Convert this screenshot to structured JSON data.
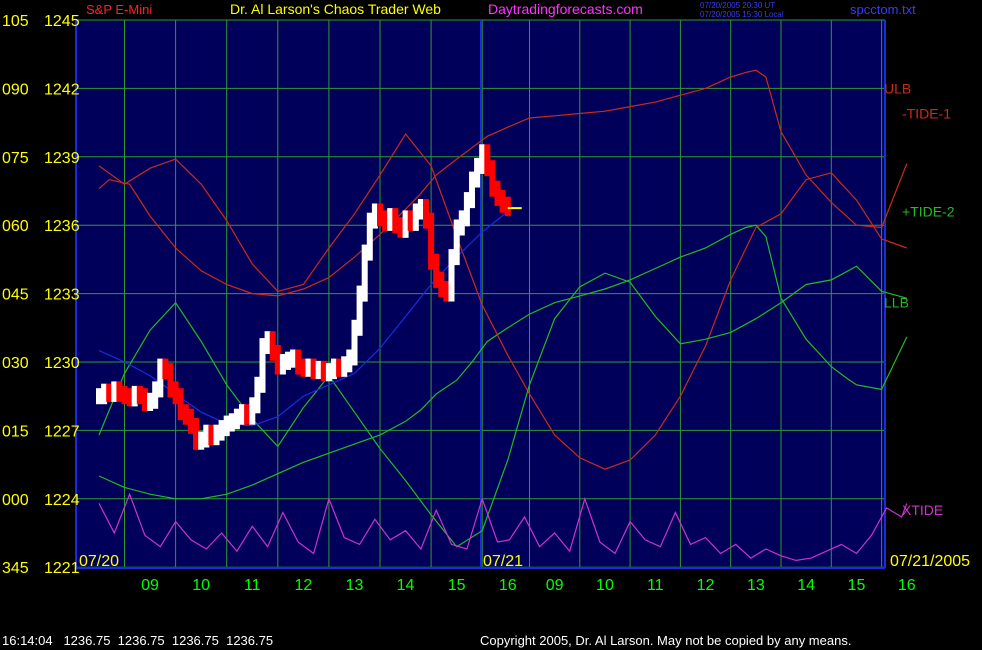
{
  "header": {
    "title_left": "S&P E-Mini",
    "title_main": "Dr. Al Larson's Chaos Trader Web",
    "site": "Daytradingforecasts.com",
    "stamp1": "07/20/2005 20:30 UT",
    "stamp2": "07/20/2005 15:30 Local",
    "file": "spcctom.txt"
  },
  "footer": {
    "quote": "16:14:04   1236.75  1236.75  1236.75  1236.75",
    "copyright": "Copyright 2005, Dr. Al Larson. May not be copied by any means."
  },
  "colors": {
    "background": "#00005a",
    "grid": "#2f9a2f",
    "price_up": "#ffffff",
    "price_down": "#ff0000",
    "ulb": "#cc2a1a",
    "llb": "#22bb22",
    "xtide": "#cc33cc",
    "average": "#1a2be0",
    "left_labels": "#ffff00",
    "time_labels": "#00ff00"
  },
  "chart_data": {
    "type": "line",
    "left_axis": {
      "labels": [
        {
          "code": "105",
          "price": "1245",
          "value": 1245
        },
        {
          "code": "090",
          "price": "1242",
          "value": 1242
        },
        {
          "code": "075",
          "price": "1239",
          "value": 1239
        },
        {
          "code": "060",
          "price": "1236",
          "value": 1236
        },
        {
          "code": "045",
          "price": "1233",
          "value": 1233
        },
        {
          "code": "030",
          "price": "1230",
          "value": 1230
        },
        {
          "code": "015",
          "price": "1227",
          "value": 1227
        },
        {
          "code": "000",
          "price": "1224",
          "value": 1224
        },
        {
          "code": "345",
          "price": "1221",
          "value": 1221
        }
      ],
      "ylim": [
        1221,
        1245
      ]
    },
    "time_axis": {
      "hours": [
        "09",
        "10",
        "11",
        "12",
        "13",
        "14",
        "15",
        "16",
        "09",
        "10",
        "11",
        "12",
        "13",
        "14",
        "15",
        "16"
      ],
      "date_start": "07/20",
      "date_mid": "07/21",
      "date_end": "07/21/2005"
    },
    "series": [
      {
        "name": "ULB",
        "color": "#cc2a1a",
        "x": [
          0,
          0.2,
          0.6,
          1.0,
          1.5,
          2.0,
          2.5,
          3.0,
          3.5,
          4.0,
          4.5,
          5.0,
          5.5,
          6.0,
          6.3,
          6.6,
          7.0,
          7.3,
          7.6,
          8.0,
          8.5,
          9.0,
          9.5,
          10.0,
          10.5,
          11.0,
          11.5,
          12.0,
          12.5,
          12.8,
          13.0,
          13.2,
          13.5,
          14.0,
          14.5,
          14.8,
          15.0,
          15.5,
          16.0
        ],
        "y": [
          1237.6,
          1238.0,
          1237.8,
          1236.4,
          1235.0,
          1234.0,
          1233.4,
          1233.0,
          1232.9,
          1233.2,
          1233.7,
          1234.6,
          1235.6,
          1236.7,
          1237.4,
          1238.2,
          1238.9,
          1239.4,
          1239.9,
          1240.3,
          1240.7,
          1240.8,
          1240.9,
          1241.0,
          1241.2,
          1241.4,
          1241.7,
          1242.0,
          1242.5,
          1242.7,
          1242.8,
          1242.5,
          1240.1,
          1238.2,
          1237.0,
          1236.4,
          1236.0,
          1235.9,
          1238.7
        ]
      },
      {
        "name": "LLB",
        "color": "#22bb22",
        "x": [
          0,
          0.5,
          1.0,
          1.5,
          2.0,
          2.5,
          3.0,
          3.5,
          4.0,
          4.5,
          5.0,
          5.5,
          6.0,
          6.3,
          6.6,
          7.0,
          7.3,
          7.6,
          8.0,
          8.5,
          9.0,
          9.5,
          10.0,
          10.5,
          11.0,
          11.5,
          12.0,
          12.5,
          12.8,
          13.0,
          13.2,
          13.5,
          14.0,
          14.5,
          14.8,
          15.0,
          15.5,
          16.0
        ],
        "y": [
          1225.0,
          1224.5,
          1224.2,
          1224.0,
          1224.0,
          1224.2,
          1224.6,
          1225.1,
          1225.6,
          1226.0,
          1226.4,
          1226.8,
          1227.4,
          1227.9,
          1228.6,
          1229.2,
          1230.0,
          1230.9,
          1231.5,
          1232.1,
          1232.6,
          1232.9,
          1233.2,
          1233.6,
          1234.1,
          1234.6,
          1235.0,
          1235.6,
          1235.9,
          1236.0,
          1235.5,
          1232.8,
          1231.0,
          1229.8,
          1229.3,
          1229.0,
          1228.8,
          1231.1
        ]
      },
      {
        "name": "-TIDE-1",
        "color": "#cc2a1a",
        "x": [
          0,
          0.5,
          1.0,
          1.5,
          2.0,
          2.5,
          3.0,
          3.5,
          4.0,
          4.5,
          5.0,
          5.5,
          6.0,
          6.5,
          7.0,
          7.5,
          8.0,
          8.5,
          9.0,
          9.5,
          10.0,
          10.5,
          11.0,
          11.5,
          12.0,
          12.5,
          13.0,
          13.5,
          14.0,
          14.5,
          15.0,
          15.5,
          16.0
        ],
        "y": [
          1238.6,
          1237.8,
          1238.5,
          1238.9,
          1237.8,
          1236.2,
          1234.3,
          1233.1,
          1233.4,
          1235.0,
          1236.5,
          1238.2,
          1240.0,
          1238.6,
          1235.5,
          1232.5,
          1230.3,
          1228.6,
          1226.8,
          1225.8,
          1225.3,
          1225.7,
          1226.8,
          1228.5,
          1230.7,
          1233.6,
          1235.9,
          1236.5,
          1238.0,
          1238.3,
          1237.1,
          1235.4,
          1235.0
        ]
      },
      {
        "name": "+TIDE-2",
        "color": "#22bb22",
        "x": [
          0,
          0.5,
          1.0,
          1.5,
          2.0,
          2.5,
          3.0,
          3.5,
          4.0,
          4.5,
          5.0,
          5.5,
          6.0,
          6.5,
          7.0,
          7.5,
          8.0,
          8.5,
          9.0,
          9.5,
          10.0,
          10.5,
          11.0,
          11.5,
          12.0,
          12.5,
          13.0,
          13.5,
          14.0,
          14.5,
          15.0,
          15.5,
          16.0
        ],
        "y": [
          1226.8,
          1229.5,
          1231.4,
          1232.6,
          1230.9,
          1229.0,
          1227.5,
          1226.3,
          1228.0,
          1229.4,
          1227.8,
          1226.2,
          1224.8,
          1223.3,
          1221.9,
          1222.6,
          1225.7,
          1229.0,
          1231.9,
          1233.3,
          1233.9,
          1233.5,
          1232.0,
          1230.8,
          1231.0,
          1231.3,
          1231.9,
          1232.6,
          1233.4,
          1233.6,
          1234.2,
          1233.1,
          1232.8
        ]
      },
      {
        "name": "XTIDE",
        "color": "#cc33cc",
        "x": [
          0,
          0.3,
          0.6,
          0.9,
          1.2,
          1.5,
          1.8,
          2.1,
          2.4,
          2.7,
          3.0,
          3.3,
          3.6,
          3.9,
          4.2,
          4.5,
          4.8,
          5.1,
          5.4,
          5.7,
          6.0,
          6.3,
          6.6,
          6.9,
          7.2,
          7.5,
          7.8,
          8.1,
          8.4,
          8.7,
          9.0,
          9.3,
          9.6,
          9.9,
          10.2,
          10.5,
          10.8,
          11.1,
          11.4,
          11.7,
          12.0,
          12.3,
          12.6,
          12.9,
          13.2,
          13.5,
          13.8,
          14.1,
          14.4,
          14.7,
          15.0,
          15.3,
          15.6,
          15.9,
          16.0
        ],
        "y": [
          1223.8,
          1222.5,
          1224.2,
          1222.4,
          1221.9,
          1223.0,
          1222.2,
          1221.8,
          1222.5,
          1221.7,
          1222.8,
          1221.9,
          1223.4,
          1222.1,
          1221.6,
          1224.0,
          1222.3,
          1222.0,
          1223.1,
          1222.2,
          1222.6,
          1221.8,
          1223.5,
          1222.0,
          1221.8,
          1224.0,
          1222.1,
          1222.2,
          1223.2,
          1221.9,
          1222.5,
          1221.7,
          1224.0,
          1222.1,
          1221.6,
          1223.0,
          1222.2,
          1221.9,
          1223.4,
          1222.0,
          1222.3,
          1221.6,
          1222.0,
          1221.4,
          1221.8,
          1221.5,
          1221.3,
          1221.4,
          1221.7,
          1222.0,
          1221.6,
          1222.4,
          1223.6,
          1223.2,
          1223.8
        ]
      },
      {
        "name": "Price",
        "color": "#ffffff",
        "x": [
          0,
          0.1,
          0.2,
          0.3,
          0.4,
          0.5,
          0.6,
          0.7,
          0.8,
          0.9,
          1.0,
          1.1,
          1.2,
          1.3,
          1.4,
          1.5,
          1.6,
          1.7,
          1.8,
          1.9,
          2.0,
          2.1,
          2.2,
          2.3,
          2.4,
          2.5,
          2.6,
          2.7,
          2.8,
          2.9,
          3.0,
          3.1,
          3.2,
          3.3,
          3.4,
          3.5,
          3.6,
          3.7,
          3.8,
          3.9,
          4.0,
          4.1,
          4.2,
          4.3,
          4.4,
          4.5,
          4.6,
          4.7,
          4.8,
          4.9,
          5.0,
          5.1,
          5.2,
          5.3,
          5.4,
          5.5,
          5.6,
          5.7,
          5.8,
          5.9,
          6.0,
          6.1,
          6.2,
          6.3,
          6.4,
          6.5,
          6.6,
          6.7,
          6.8,
          6.9,
          7.0,
          7.1,
          7.2,
          7.3,
          7.4,
          7.5,
          7.6,
          7.7,
          7.8,
          7.9,
          8.0
        ],
        "y": [
          1228.5,
          1228.7,
          1228.6,
          1228.8,
          1228.6,
          1228.5,
          1228.4,
          1228.6,
          1228.5,
          1228.2,
          1228.3,
          1228.8,
          1229.8,
          1229.6,
          1228.8,
          1228.5,
          1227.8,
          1227.6,
          1227.2,
          1226.5,
          1226.6,
          1226.9,
          1226.7,
          1226.9,
          1227.1,
          1227.3,
          1227.4,
          1227.6,
          1227.8,
          1227.6,
          1228.1,
          1229.0,
          1230.7,
          1231.0,
          1230.4,
          1229.8,
          1230.0,
          1230.1,
          1230.2,
          1229.8,
          1229.7,
          1229.8,
          1229.6,
          1229.7,
          1229.5,
          1229.6,
          1229.8,
          1229.7,
          1229.9,
          1230.2,
          1231.5,
          1233.0,
          1234.8,
          1236.2,
          1236.6,
          1236.3,
          1236.1,
          1236.4,
          1236.0,
          1235.8,
          1236.3,
          1236.1,
          1236.6,
          1236.8,
          1236.2,
          1234.4,
          1233.6,
          1233.2,
          1233.0,
          1234.6,
          1235.9,
          1236.3,
          1237.1,
          1238.0,
          1238.6,
          1239.2,
          1238.5,
          1237.6,
          1237.2,
          1236.9,
          1236.75
        ]
      },
      {
        "name": "Average",
        "color": "#1a2be0",
        "x": [
          0,
          0.5,
          1.0,
          1.5,
          2.0,
          2.5,
          3.0,
          3.5,
          4.0,
          4.5,
          5.0,
          5.5,
          6.0,
          6.5,
          7.0,
          7.5,
          8.0
        ],
        "y": [
          1230.5,
          1230.0,
          1229.4,
          1228.6,
          1227.8,
          1227.3,
          1227.2,
          1227.6,
          1228.5,
          1229.0,
          1229.5,
          1230.6,
          1232.0,
          1233.4,
          1234.6,
          1235.7,
          1236.6
        ]
      }
    ],
    "annotations": [
      {
        "label": "ULB",
        "x": 16.0,
        "y": 1242.0
      },
      {
        "label": "-TIDE-1",
        "x": 16.0,
        "y": 1240.9
      },
      {
        "label": "+TIDE-2",
        "x": 16.0,
        "y": 1236.6
      },
      {
        "label": "LLB",
        "x": 16.0,
        "y": 1232.6
      },
      {
        "label": "XTIDE",
        "x": 16.0,
        "y": 1223.5
      }
    ]
  }
}
